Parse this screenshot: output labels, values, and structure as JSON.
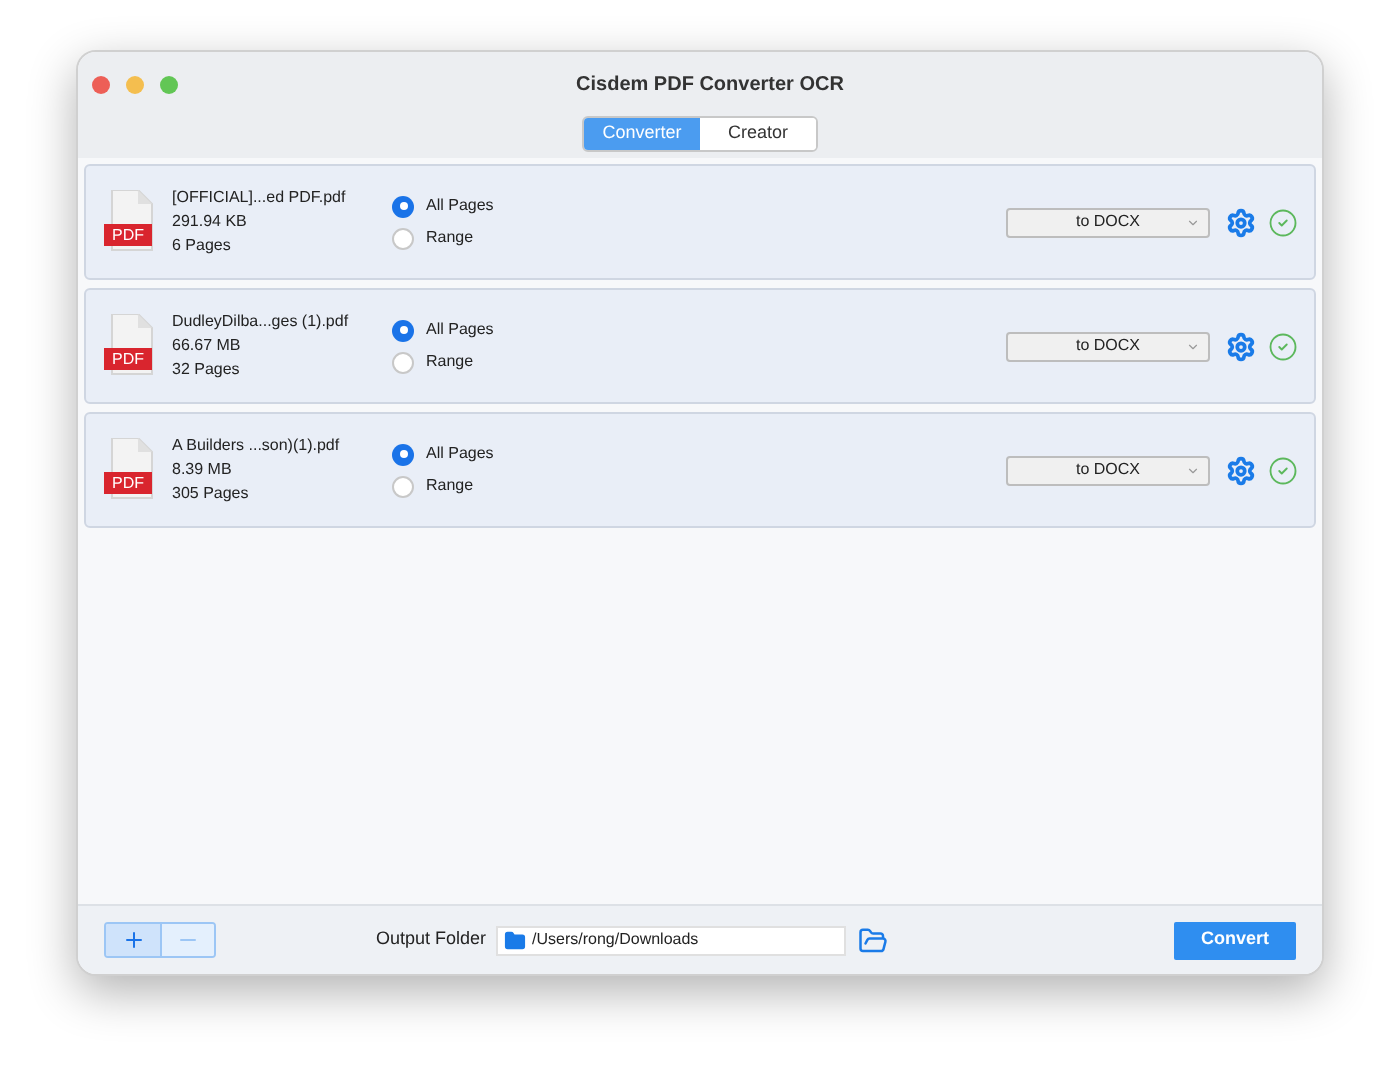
{
  "window": {
    "title": "Cisdem PDF Converter OCR"
  },
  "tabs": [
    {
      "label": "Converter",
      "selected": true
    },
    {
      "label": "Creator",
      "selected": false
    }
  ],
  "files": [
    {
      "name": "[OFFICIAL]...ed PDF.pdf",
      "size": "291.94 KB",
      "pages": "6 Pages",
      "icon_label": "PDF",
      "options": [
        {
          "label": "All Pages",
          "selected": true
        },
        {
          "label": "Range",
          "selected": false
        }
      ],
      "format": "to DOCX",
      "done": true
    },
    {
      "name": "DudleyDilba...ges (1).pdf",
      "size": "66.67 MB",
      "pages": "32 Pages",
      "icon_label": "PDF",
      "options": [
        {
          "label": "All Pages",
          "selected": true
        },
        {
          "label": "Range",
          "selected": false
        }
      ],
      "format": "to DOCX",
      "done": true
    },
    {
      "name": "A Builders ...son)(1).pdf",
      "size": "8.39 MB",
      "pages": "305 Pages",
      "icon_label": "PDF",
      "options": [
        {
          "label": "All Pages",
          "selected": true
        },
        {
          "label": "Range",
          "selected": false
        }
      ],
      "format": "to DOCX",
      "done": true
    }
  ],
  "bottom_bar": {
    "add_button": {
      "disabled": false
    },
    "remove_button": {
      "disabled": true
    },
    "output_label": "Output Folder",
    "output_path": "/Users/rong/Downloads",
    "convert_button": "Convert"
  }
}
